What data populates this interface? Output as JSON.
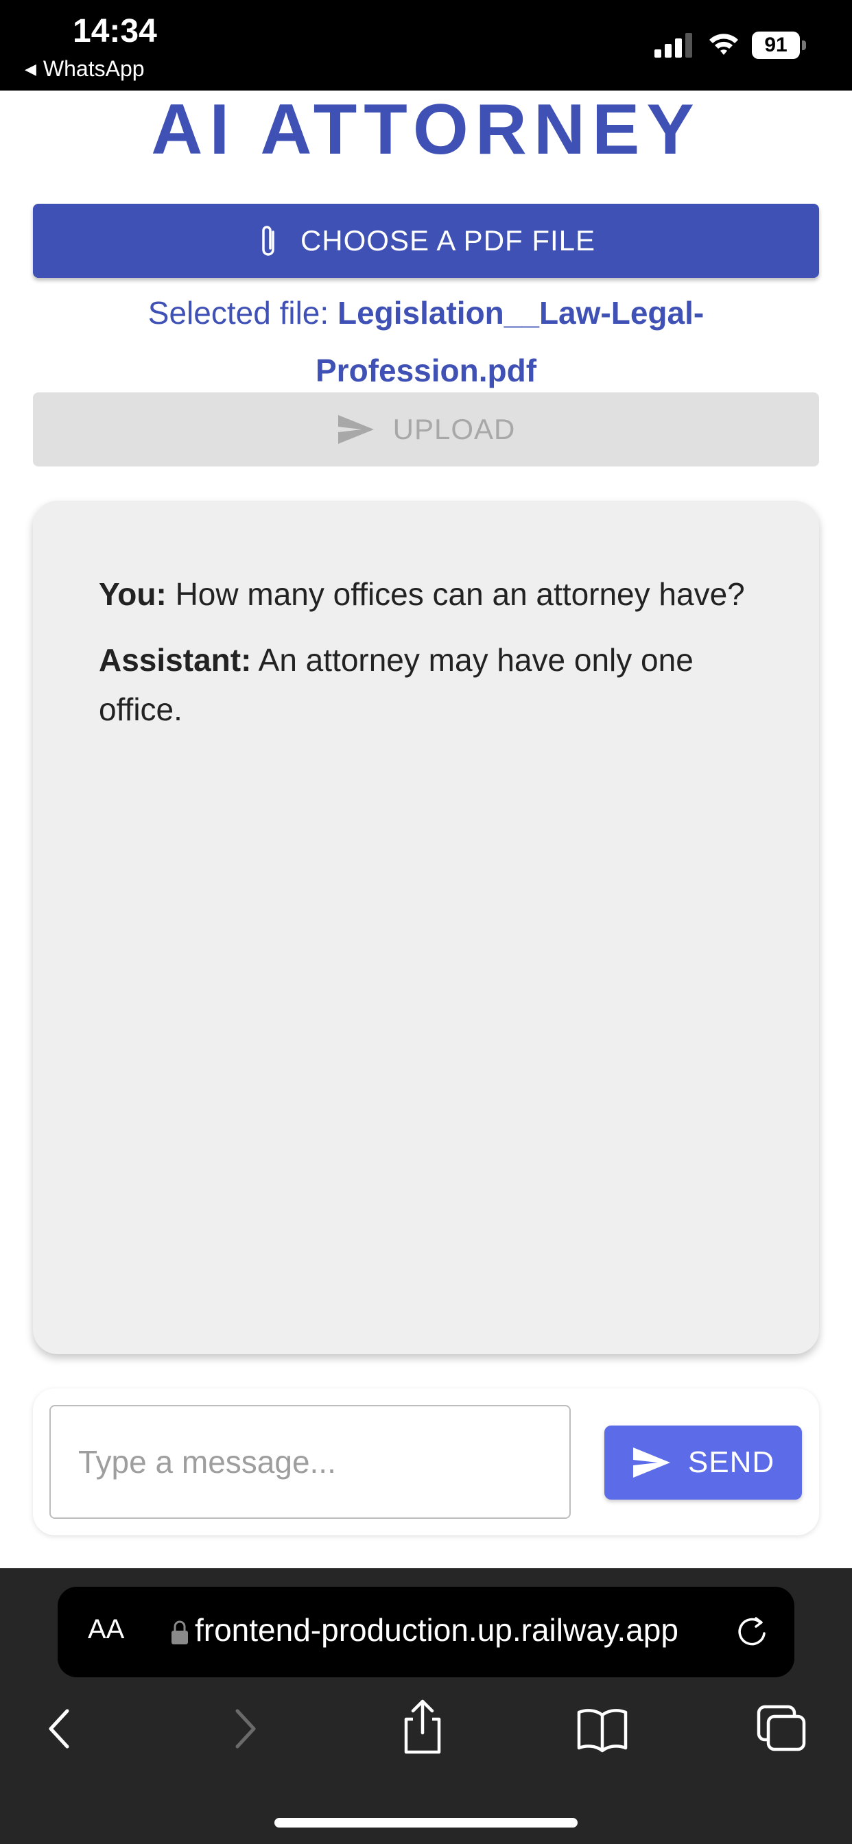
{
  "status_bar": {
    "time": "14:34",
    "back_app": "WhatsApp",
    "battery": "91",
    "icons": [
      "signal-icon",
      "wifi-icon",
      "battery-icon"
    ]
  },
  "app": {
    "title": "AI ATTORNEY",
    "choose_button": "CHOOSE A PDF FILE",
    "selected_prefix": "Selected file: ",
    "selected_file": "Legislation__Law-Legal-Profession.pdf",
    "upload_button": "UPLOAD"
  },
  "chat": {
    "messages": [
      {
        "sender": "You:",
        "text": " How many offices can an attorney have?"
      },
      {
        "sender": "Assistant:",
        "text": " An attorney may have only one office."
      }
    ]
  },
  "composer": {
    "placeholder": "Type a message...",
    "value": "",
    "send_button": "SEND"
  },
  "browser": {
    "text_size_label": "AA",
    "url": "frontend-production.up.railway.app",
    "toolbar_icons": [
      "back-icon",
      "forward-icon",
      "share-icon",
      "bookmarks-icon",
      "tabs-icon"
    ]
  },
  "colors": {
    "primary": "#3f51b5",
    "send": "#5c6be8",
    "disabled": "#e0e0e0",
    "chat_bg": "#efefef"
  }
}
